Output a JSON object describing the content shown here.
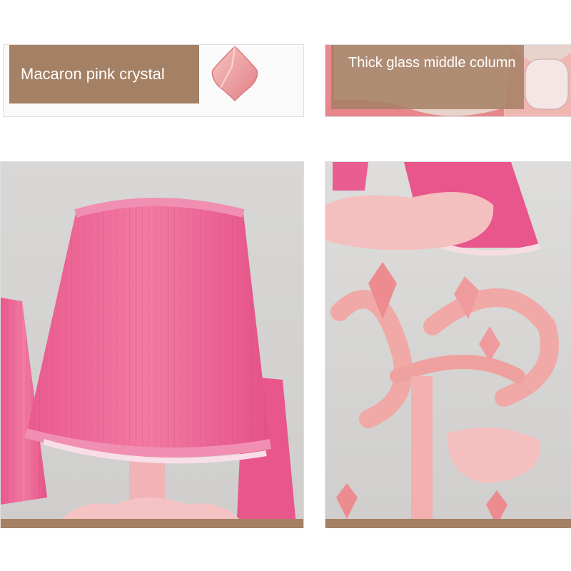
{
  "panels": {
    "crystal": {
      "label": "Macaron pink crystal"
    },
    "column": {
      "label": "Thick glass middle column"
    },
    "shade_photo": {
      "label": ""
    },
    "arms_photo": {
      "label": ""
    }
  },
  "colors": {
    "label_bg": "#a48064",
    "pink_shade": "#ee5f92",
    "pale_pink": "#f2a6a6",
    "bg_gray": "#dcdbd9"
  }
}
